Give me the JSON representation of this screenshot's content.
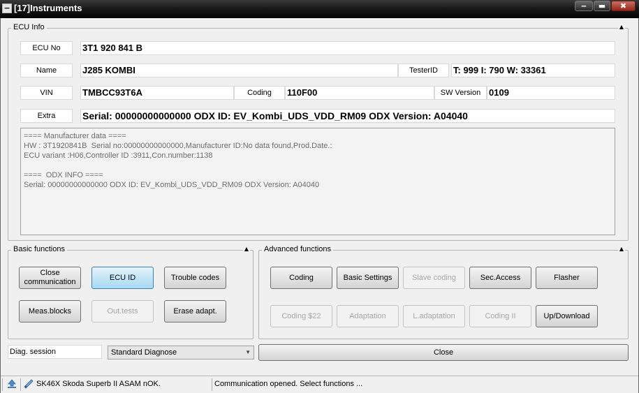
{
  "window": {
    "title": "[17]Instruments",
    "sys_icon": "minus-icon",
    "min_glyph": "‒",
    "max_glyph": "▬",
    "close_glyph": "✖"
  },
  "ecu_info": {
    "group_label": "ECU Info",
    "ecu_no_label": "ECU No",
    "ecu_no": "3T1 920 841 B",
    "name_label": "Name",
    "name": "J285  KOMBI",
    "tester_id_label": "TesterID",
    "tester_id": "T: 999 I: 790 W: 33361",
    "vin_label": "VIN",
    "vin": "TMBCC93T6A",
    "coding_label": "Coding",
    "coding": "110F00",
    "sw_version_label": "SW Version",
    "sw_version": "0109",
    "extra_label": "Extra",
    "extra": "Serial: 00000000000000 ODX ID: EV_Kombi_UDS_VDD_RM09 ODX Version: A04040",
    "manufacturer_data": "==== Manufacturer data ====\nHW : 3T1920841B  Serial no:00000000000000,Manufacturer ID:No data found,Prod.Date.:\nECU variant :H06,Controller ID :3911,Con.number:1138\n\n====  ODX INFO ====\nSerial: 00000000000000 ODX ID: EV_Kombi_UDS_VDD_RM09 ODX Version: A04040"
  },
  "basic": {
    "group_label": "Basic functions",
    "close_comm": "Close communication",
    "ecu_id": "ECU ID",
    "trouble_codes": "Trouble codes",
    "meas_blocks": "Meas.blocks",
    "out_tests": "Out.tests",
    "erase_adapt": "Erase adapt."
  },
  "advanced": {
    "group_label": "Advanced functions",
    "coding": "Coding",
    "basic_settings": "Basic Settings",
    "slave_coding": "Slave coding",
    "sec_access": "Sec.Access",
    "flasher": "Flasher",
    "coding_22": "Coding $22",
    "adaptation": "Adaptation",
    "l_adaptation": "L.adaptation",
    "coding_ii": "Coding II",
    "up_download": "Up/Download"
  },
  "diag": {
    "label": "Diag. session",
    "selected": "Standard Diagnose",
    "close": "Close"
  },
  "status": {
    "vehicle": "SK46X Skoda Superb II ASAM nOK.",
    "message": "Communication opened. Select functions ..."
  },
  "colors": {
    "titlebar": "#151515",
    "active_button": "#c4e5f6",
    "close_red": "#9a2418"
  }
}
